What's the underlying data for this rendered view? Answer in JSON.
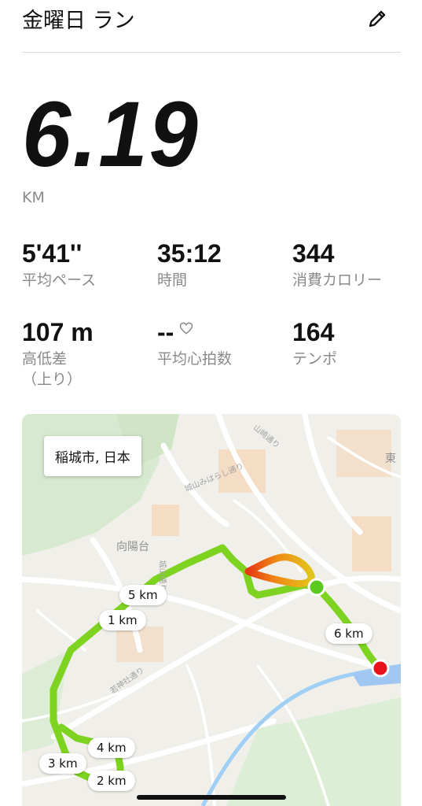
{
  "header": {
    "title": "金曜日 ラン",
    "edit_icon": "pencil-icon"
  },
  "summary": {
    "distance": "6.19",
    "unit": "KM"
  },
  "stats": [
    {
      "value": "5'41''",
      "label": "平均ペース"
    },
    {
      "value": "35:12",
      "label": "時間"
    },
    {
      "value": "344",
      "label": "消費カロリー"
    },
    {
      "value": "107 m",
      "label": "高低差\n（上り）"
    },
    {
      "value": "--",
      "label": "平均心拍数",
      "icon": "heart-outline-icon"
    },
    {
      "value": "164",
      "label": "テンポ"
    }
  ],
  "map": {
    "location": "稲城市, 日本",
    "place_labels": [
      "向陽台",
      "東",
      "山崎通り",
      "城山みはらし通り",
      "城山通り",
      "若神社通り"
    ],
    "km_markers": [
      "1 km",
      "2 km",
      "3 km",
      "4 km",
      "5 km",
      "6 km"
    ],
    "colors": {
      "route": "#7ed321",
      "start": "#5cc91f",
      "end": "#e8101b",
      "slow": "#f08a16",
      "slowest": "#e53a12"
    }
  }
}
